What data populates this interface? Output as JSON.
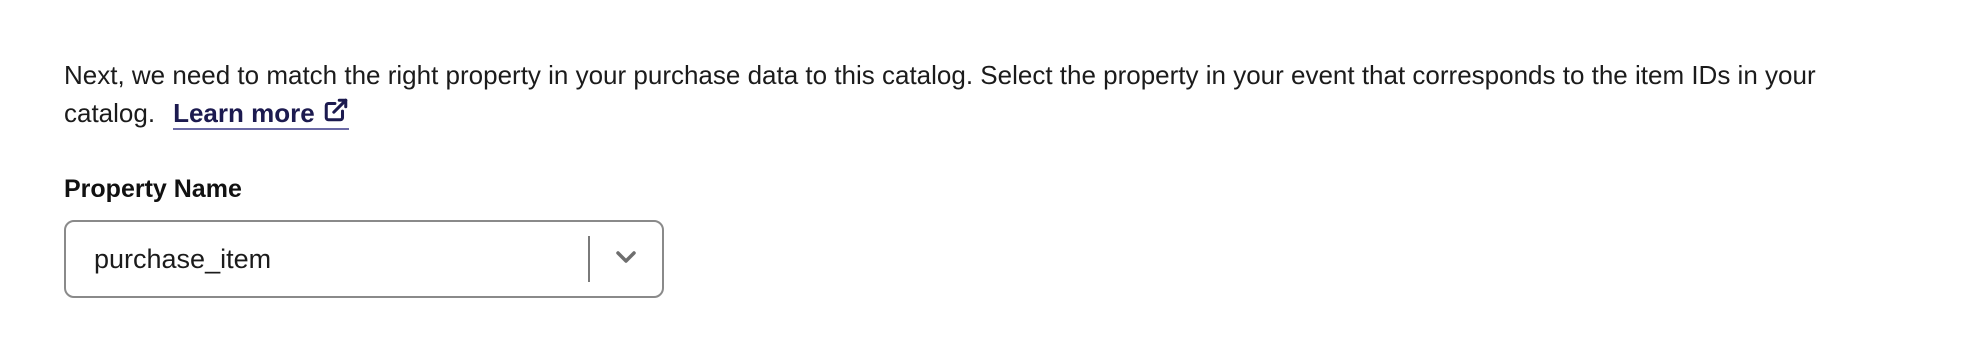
{
  "description": {
    "text": "Next, we need to match the right property in your purchase data to this catalog. Select the property in your event that corresponds to the item IDs in your catalog.",
    "learn_more_label": "Learn more",
    "link_icon": "external-link-icon"
  },
  "property_field": {
    "label": "Property Name",
    "selected_value": "purchase_item",
    "dropdown_icon": "chevron-down-icon"
  },
  "colors": {
    "link": "#1c1a4f",
    "link_underline": "#6b6aa6",
    "border": "#8a8a8a",
    "text": "#1b1b1b"
  }
}
